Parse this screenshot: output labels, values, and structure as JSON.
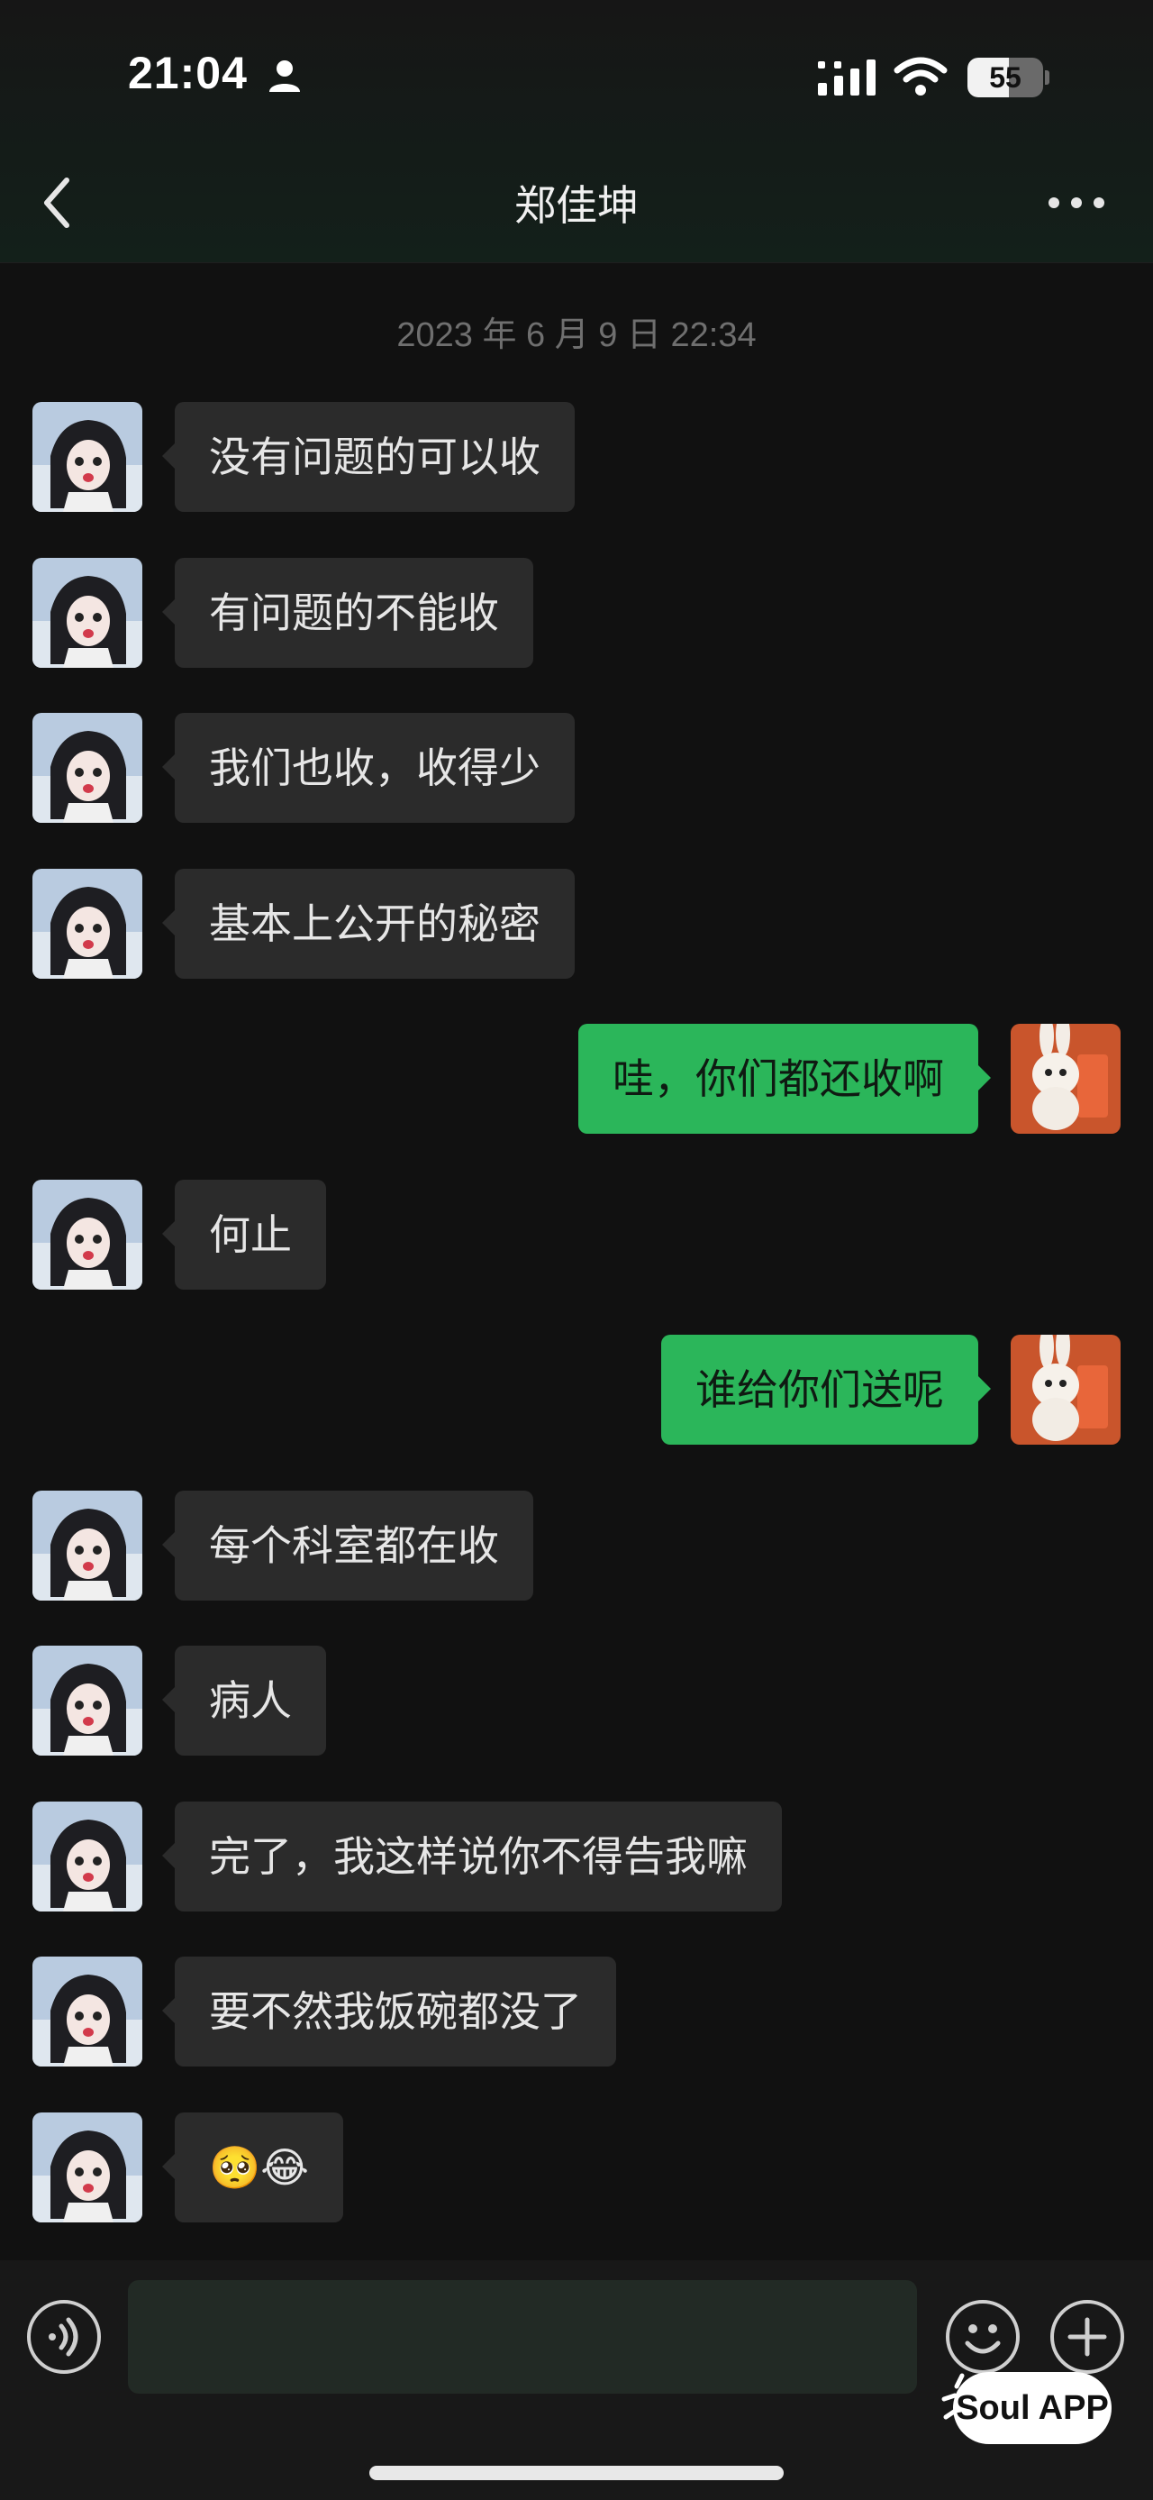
{
  "status_bar": {
    "time": "21:04",
    "battery": "55",
    "battery_level_percent": 55,
    "icons": [
      "person-icon",
      "signal-icon",
      "wifi-icon",
      "battery-icon"
    ]
  },
  "header": {
    "title": "郑佳坤",
    "back_icon": "chevron-left-icon",
    "more_icon": "more-dots-icon"
  },
  "timestamp": "2023 年 6 月 9 日  22:34",
  "messages": [
    {
      "side": "left",
      "text": "没有问题的可以收"
    },
    {
      "side": "left",
      "text": "有问题的不能收"
    },
    {
      "side": "left",
      "text": "我们也收，收得少"
    },
    {
      "side": "left",
      "text": "基本上公开的秘密"
    },
    {
      "side": "right",
      "text": "哇，你们都还收啊"
    },
    {
      "side": "left",
      "text": "何止"
    },
    {
      "side": "right",
      "text": "谁给你们送呢"
    },
    {
      "side": "left",
      "text": "每个科室都在收"
    },
    {
      "side": "left",
      "text": "病人"
    },
    {
      "side": "left",
      "text": "完了，我这样说你不得告我嘛"
    },
    {
      "side": "left",
      "text": "要不然我饭碗都没了"
    },
    {
      "side": "left",
      "text": "🥺😂"
    }
  ],
  "input_bar": {
    "placeholder": "",
    "voice_icon": "voice-icon",
    "emoji_icon": "emoji-icon",
    "plus_icon": "plus-icon"
  },
  "watermark": {
    "text": "Soul APP"
  },
  "colors": {
    "background": "#111111",
    "incoming_bubble": "#2b2b2b",
    "outgoing_bubble": "#2bb65a",
    "timestamp": "#6f6f6f"
  }
}
